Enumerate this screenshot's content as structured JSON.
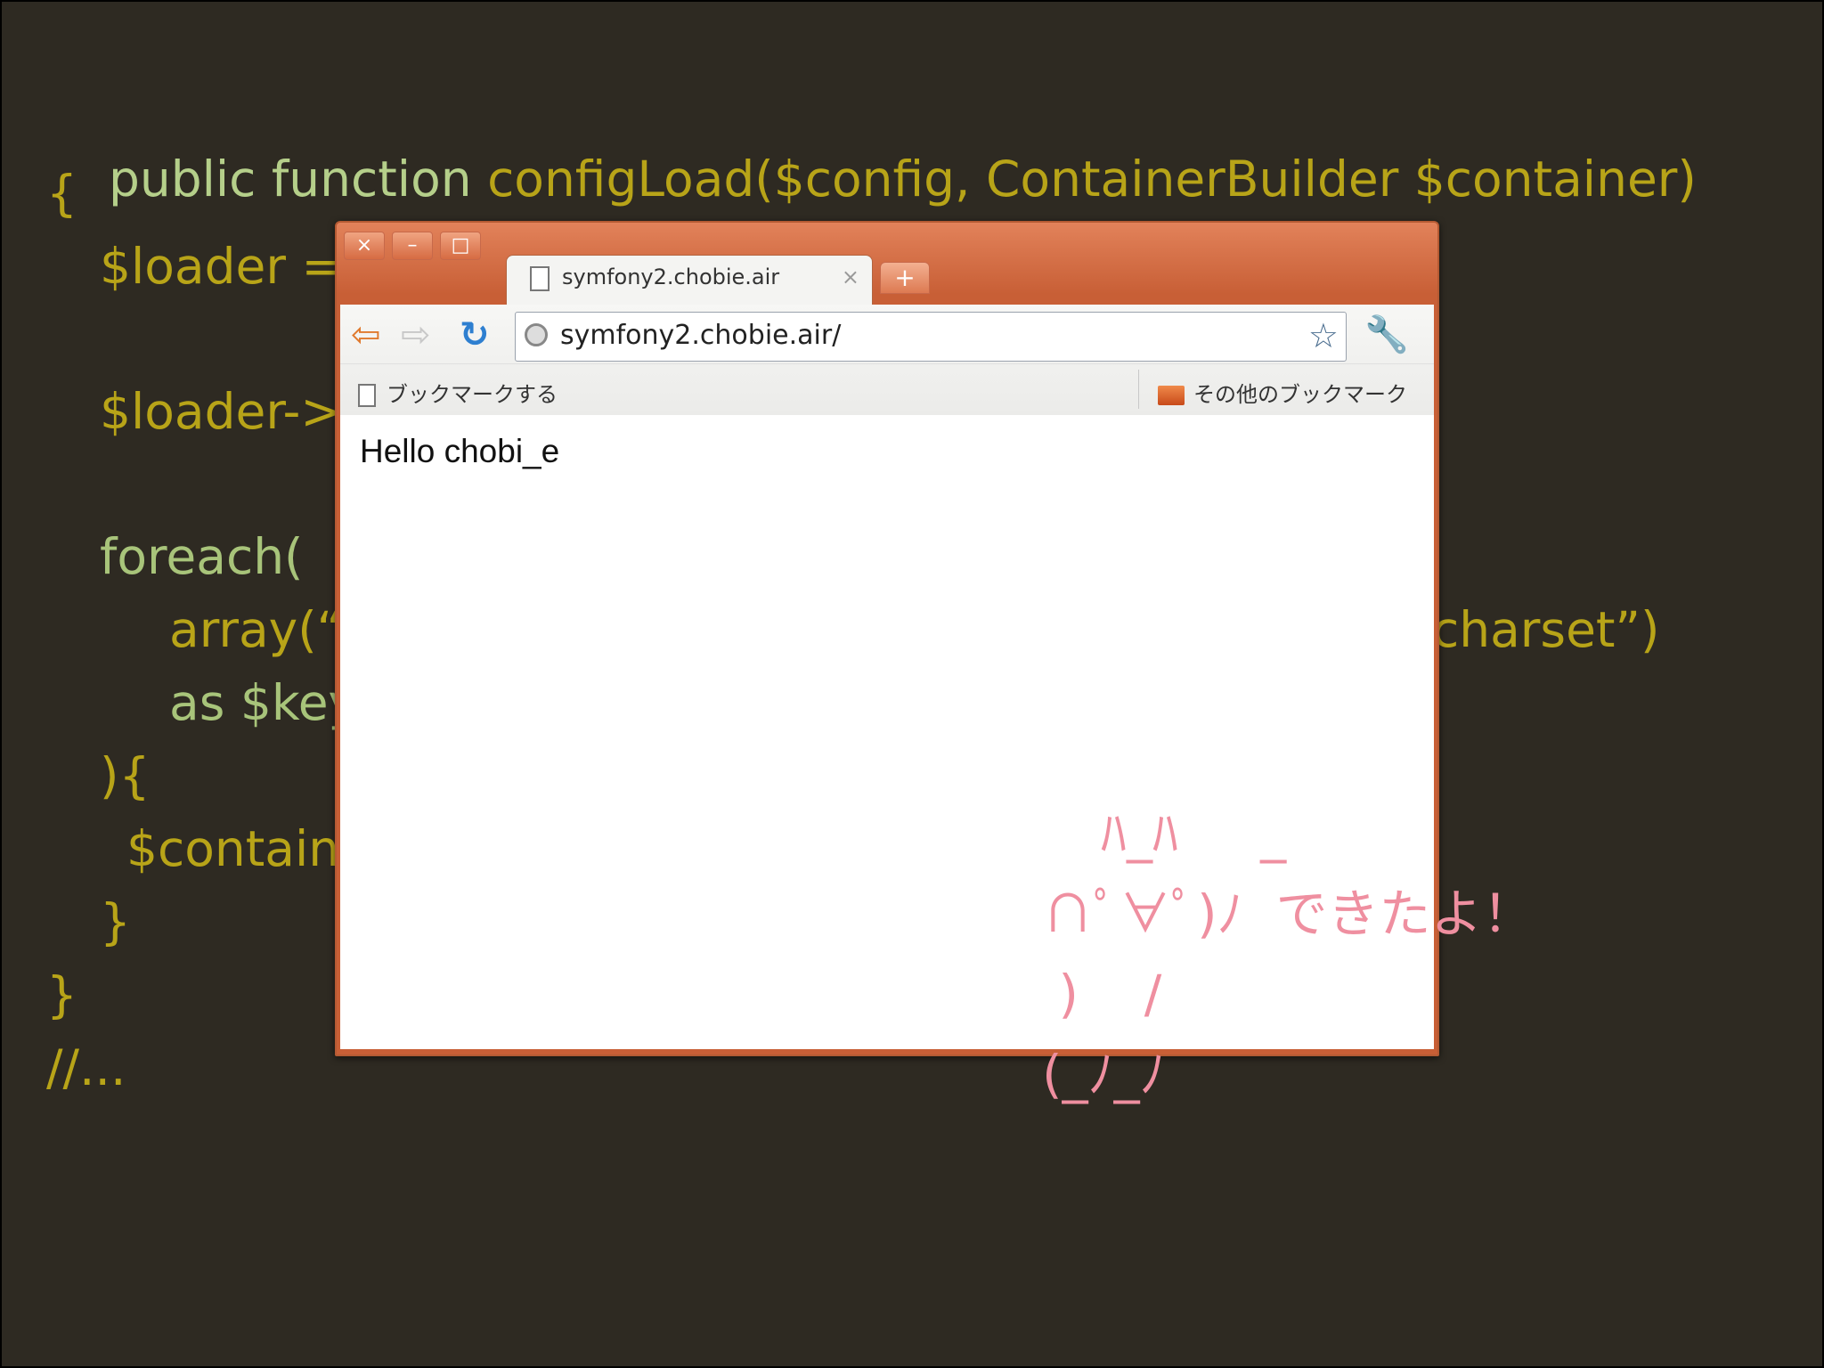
{
  "code": {
    "line1_keyword": "public function ",
    "line1_rest": "configLoad($config, ContainerBuilder $container)",
    "line2": "{",
    "line3": "$loader =",
    "line4": "$loader->",
    "line5": "foreach(",
    "line6_left": "array(“",
    "line6_right": "charset”)",
    "line7": "as $key",
    "line8": "){",
    "line9": "$contain",
    "line10": "}",
    "line11": "}",
    "line12": "//..."
  },
  "browser": {
    "window_buttons": [
      "×",
      "–",
      "□"
    ],
    "tab_title": "symfony2.chobie.air",
    "tab_close": "×",
    "new_tab": "+",
    "nav": {
      "back": "⇦",
      "forward": "⇨",
      "reload": "↻"
    },
    "url": "symfony2.chobie.air/",
    "star": "☆",
    "wrench": "🔧",
    "bookmark_this": "ブックマークする",
    "other_bookmarks": "その他のブックマーク",
    "page_text": "Hello chobi_e"
  },
  "overlay": {
    "line1": "ﾊ_ﾊ     _",
    "line2": "∩ﾟ∀ﾟ)ﾉ  できたよ！",
    "line3": " )    /",
    "line4": "(_ﾉ_ﾉ"
  },
  "colors": {
    "background": "#2e2a22",
    "code_yellow": "#b8a418",
    "code_green": "#b5cf8a",
    "browser_frame": "#d06a40",
    "overlay_pink": "#ef8fa0"
  }
}
